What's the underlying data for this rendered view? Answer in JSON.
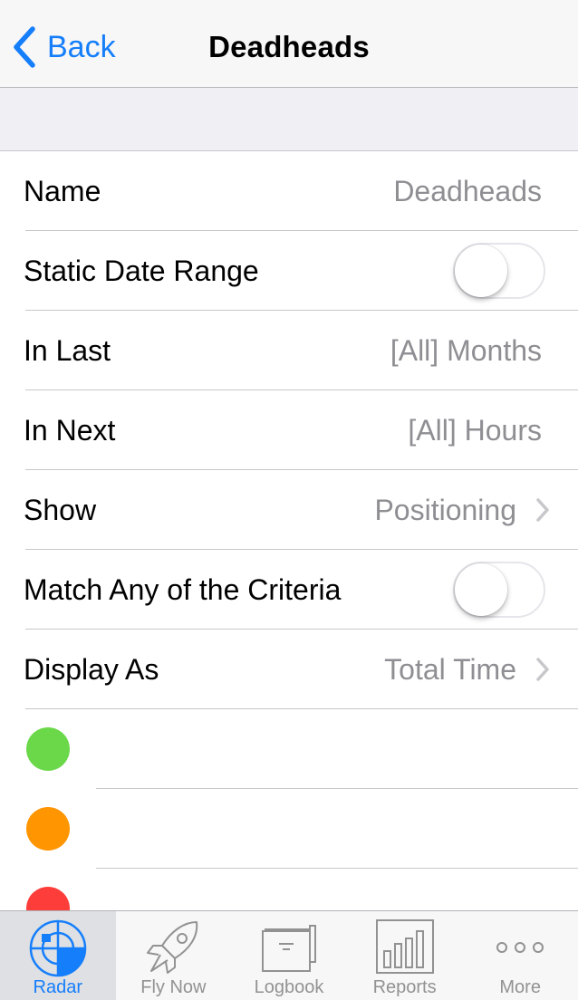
{
  "navbar": {
    "back_label": "Back",
    "title": "Deadheads"
  },
  "rows": {
    "name": {
      "label": "Name",
      "value": "Deadheads"
    },
    "static_date_range": {
      "label": "Static Date Range",
      "toggle_on": false
    },
    "in_last": {
      "label": "In Last",
      "value": "[All] Months"
    },
    "in_next": {
      "label": "In Next",
      "value": "[All] Hours"
    },
    "show": {
      "label": "Show",
      "value": "Positioning"
    },
    "match_any": {
      "label": "Match Any of the Criteria",
      "toggle_on": false
    },
    "display_as": {
      "label": "Display As",
      "value": "Total Time"
    }
  },
  "color_options": [
    "#6bd84a",
    "#ff9500",
    "#fc3d39"
  ],
  "colors": {
    "accent": "#157efb",
    "secondary_text": "#8e8e93"
  },
  "tabbar": {
    "active": "Radar",
    "tabs": [
      {
        "label": "Radar",
        "icon": "radar-icon"
      },
      {
        "label": "Fly Now",
        "icon": "rocket-icon"
      },
      {
        "label": "Logbook",
        "icon": "logbook-icon"
      },
      {
        "label": "Reports",
        "icon": "reports-icon"
      },
      {
        "label": "More",
        "icon": "more-icon"
      }
    ]
  }
}
